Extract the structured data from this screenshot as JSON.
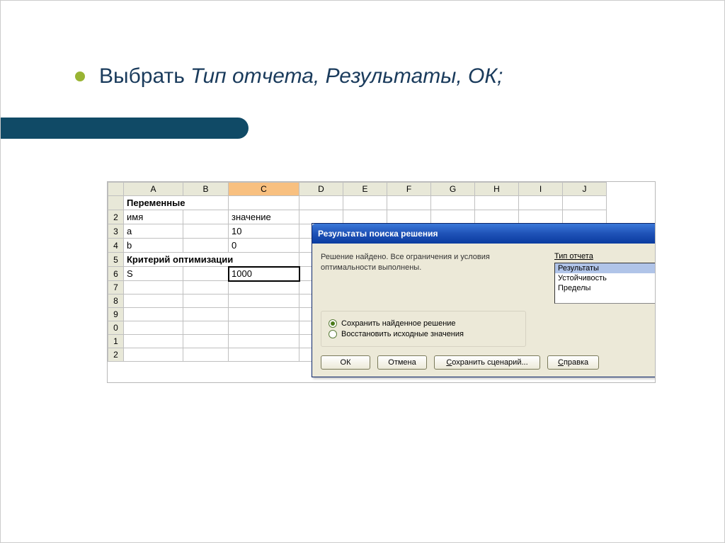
{
  "slide": {
    "title_prefix": "Выбрать ",
    "title_italic": "Тип отчета, Результаты, ОК;"
  },
  "spreadsheet": {
    "columns": [
      "A",
      "B",
      "C",
      "D",
      "E",
      "F",
      "G",
      "H",
      "I",
      "J"
    ],
    "row_numbers": [
      "",
      "2",
      "3",
      "4",
      "5",
      "6",
      "7",
      "8",
      "9",
      "0",
      "1",
      "2"
    ],
    "rows": [
      {
        "a": "Переменные",
        "bold": true
      },
      {
        "a": "имя",
        "c": "значение"
      },
      {
        "a": "a",
        "c": "10",
        "c_align": "right"
      },
      {
        "a": "b",
        "c": "0",
        "c_align": "right"
      },
      {
        "a": "Критерий оптимизации",
        "bold": true,
        "span": 3
      },
      {
        "a": "S",
        "c": "1000",
        "c_align": "right",
        "c_active": true
      }
    ],
    "selected_column": "C"
  },
  "dialog": {
    "title": "Результаты поиска решения",
    "message_line1": "Решение найдено. Все ограничения и условия",
    "message_line2": "оптимальности выполнены.",
    "report_label": "Тип отчета",
    "report_options": [
      "Результаты",
      "Устойчивость",
      "Пределы"
    ],
    "report_selected": 0,
    "radio_keep": "Сохранить найденное решение",
    "radio_restore": "Восстановить исходные значения",
    "radio_selected": 0,
    "buttons": {
      "ok": "ОК",
      "cancel": "Отмена",
      "save_scenario": "Сохранить сценарий...",
      "help": "Справка"
    }
  }
}
